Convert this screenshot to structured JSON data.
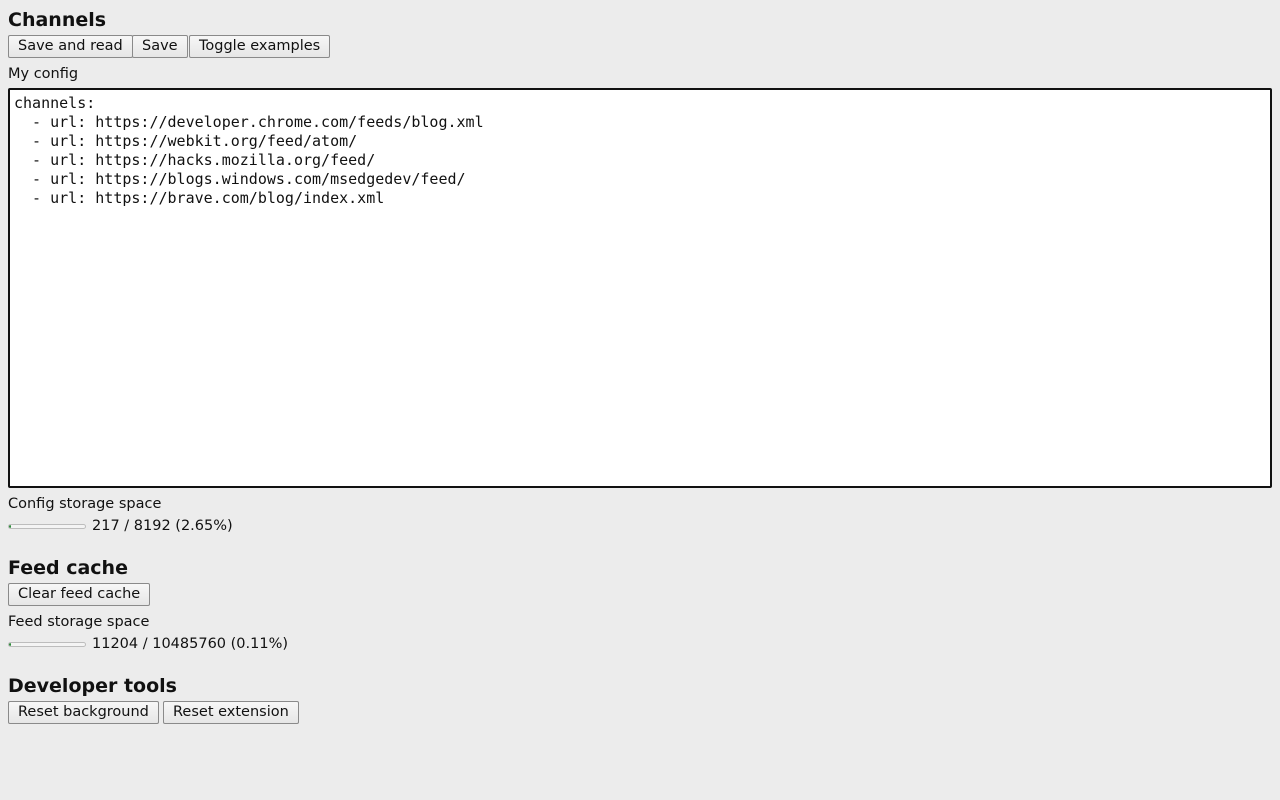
{
  "channels": {
    "heading": "Channels",
    "buttons": {
      "save_and_read": "Save and read",
      "save": "Save",
      "toggle_examples": "Toggle examples"
    },
    "config_label": "My config",
    "config_text": "channels:\n  - url: https://developer.chrome.com/feeds/blog.xml\n  - url: https://webkit.org/feed/atom/\n  - url: https://hacks.mozilla.org/feed/\n  - url: https://blogs.windows.com/msedgedev/feed/\n  - url: https://brave.com/blog/index.xml\n",
    "storage_label": "Config storage space",
    "storage_text": "217 / 8192 (2.65%)",
    "storage_fraction": 0.0265
  },
  "feed_cache": {
    "heading": "Feed cache",
    "clear_button": "Clear feed cache",
    "storage_label": "Feed storage space",
    "storage_text": "11204 / 10485760 (0.11%)",
    "storage_fraction": 0.0011
  },
  "developer_tools": {
    "heading": "Developer tools",
    "reset_background": "Reset background",
    "reset_extension": "Reset extension"
  },
  "colors": {
    "background": "#ececec",
    "progress_fill": "#2e8b3a"
  }
}
